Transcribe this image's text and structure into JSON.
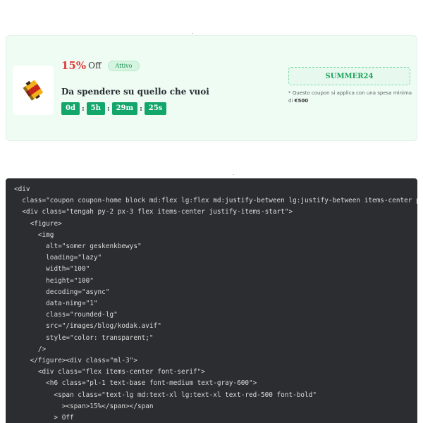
{
  "coupon": {
    "discount_value": "15%",
    "discount_suffix": "Off",
    "status_badge": "Attivo",
    "headline": "Da spendere su quello che vuoi",
    "countdown": {
      "days": "0d",
      "hours": "5h",
      "minutes": "29m",
      "seconds": "25s",
      "separator": ":"
    },
    "code": "SUMMER24",
    "note_prefix": "* Questo coupon si applica con una spesa minima di",
    "note_amount": "€500",
    "colors": {
      "accent_green": "#12a66a",
      "discount_red": "#e23b3b",
      "card_bg": "#effcf3"
    },
    "image_icon": "film-roll-icon"
  },
  "code_snippet": {
    "lines": [
      "<div",
      "  class=\"coupon coupon-home block md:flex lg:flex md:justify-between lg:justify-between items-center p",
      "  <div class=\"tengah py-2 px-3 flex items-center justify-items-start\">",
      "    <figure>",
      "      <img",
      "        alt=\"somer geskenkbewys\"",
      "        loading=\"lazy\"",
      "        width=\"100\"",
      "        height=\"100\"",
      "        decoding=\"async\"",
      "        data-nimg=\"1\"",
      "        class=\"rounded-lg\"",
      "        src=\"/images/blog/kodak.avif\"",
      "        style=\"color: transparent;\"",
      "      />",
      "    </figure><div class=\"ml-3\">",
      "      <div class=\"flex items-center font-serif\">",
      "        <h6 class=\"pl-1 text-base font-medium text-gray-600\">",
      "          <span class=\"text-lg md:text-xl lg:text-xl text-red-500 font-bold\"",
      "            ><span>15%</span></span",
      "          > Off"
    ]
  }
}
